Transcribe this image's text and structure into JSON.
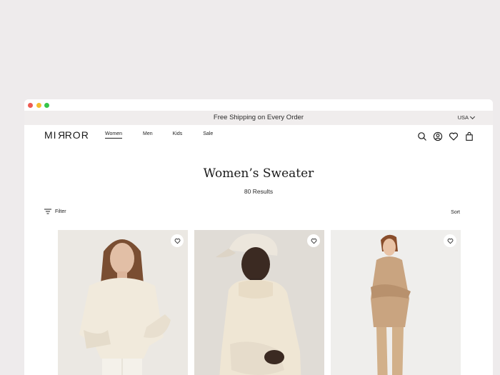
{
  "promo": {
    "message": "Free Shipping on Every Order",
    "country": "USA"
  },
  "brand": {
    "logo_left": "MI",
    "logo_rev": "R",
    "logo_right": "ROR"
  },
  "nav": {
    "women": "Women",
    "men": "Men",
    "kids": "Kids",
    "sale": "Sale"
  },
  "page": {
    "title": "Women’s Sweater",
    "results": "80 Results"
  },
  "toolbar": {
    "filter": "Filter",
    "sort": "Sort"
  },
  "colors": {
    "background": "#eeebec",
    "promo_bar": "#f0eded",
    "text": "#1f1f1f"
  },
  "icons": [
    "search-icon",
    "account-icon",
    "wishlist-icon",
    "bag-icon",
    "filter-icon",
    "heart-icon"
  ]
}
